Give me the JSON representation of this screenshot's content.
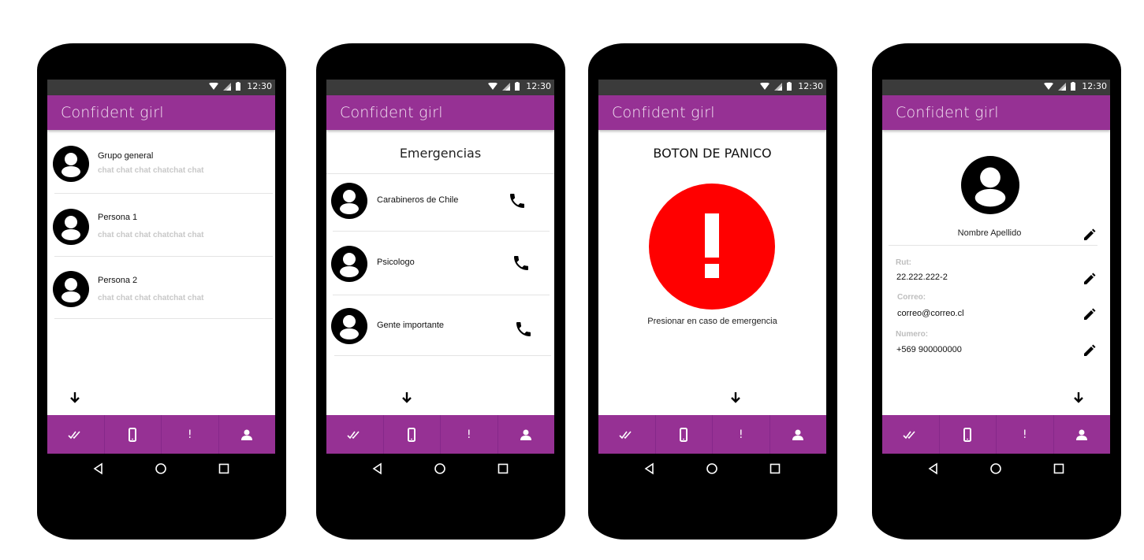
{
  "app": {
    "title": "Confident girl"
  },
  "status": {
    "time": "12:30"
  },
  "colors": {
    "primary": "#963194",
    "panic": "#ff0000",
    "statusbar": "#3b3b3b",
    "muted": "#c8c8c8"
  },
  "chats": {
    "items": [
      {
        "name": "Grupo general",
        "preview": "chat chat chat chatchat chat"
      },
      {
        "name": "Persona 1",
        "preview": "chat chat chat chatchat chat"
      },
      {
        "name": "Persona 2",
        "preview": "chat chat chat chatchat chat"
      }
    ]
  },
  "emergencias": {
    "title": "Emergencias",
    "contacts": [
      {
        "name": "Carabineros de Chile",
        "icon": "phone-icon"
      },
      {
        "name": "Psicologo",
        "icon": "phone-icon"
      },
      {
        "name": "Gente importante",
        "icon": "phone-icon"
      }
    ]
  },
  "panic": {
    "title": "BOTON DE PANICO",
    "caption": "Presionar en caso de emergencia"
  },
  "profile": {
    "name": "Nombre Apellido",
    "fields": [
      {
        "label": "Rut:",
        "value": "22.222.222-2"
      },
      {
        "label": "Correo:",
        "value": "correo@correo.cl"
      },
      {
        "label": "Numero:",
        "value": "+569 900000000"
      }
    ]
  },
  "bottom_nav": {
    "items": [
      {
        "icon": "double-check-icon"
      },
      {
        "icon": "smartphone-icon"
      },
      {
        "icon": "exclamation-icon",
        "label": "!"
      },
      {
        "icon": "person-icon"
      }
    ]
  },
  "system_nav": [
    "back-icon",
    "home-icon",
    "recents-icon"
  ]
}
